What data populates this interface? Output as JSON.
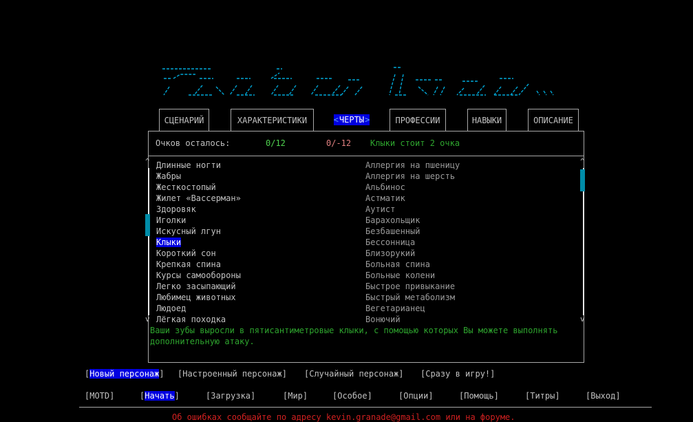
{
  "tabs": [
    {
      "label": "СЦЕНАРИЙ"
    },
    {
      "label": "ХАРАКТЕРИСТИКИ"
    },
    {
      "label": "ЧЕРТЫ",
      "active": true,
      "arrow_left": "<",
      "arrow_right": ">"
    },
    {
      "label": "ПРОФЕССИИ"
    },
    {
      "label": "НАВЫКИ"
    },
    {
      "label": "ОПИСАНИЕ"
    }
  ],
  "points": {
    "label": "Очков осталось:",
    "positive": "0/12",
    "negative": "0/-12",
    "cost": "Клыки стоит 2 очка"
  },
  "positive_traits": [
    "Длинные ногти",
    "Жабры",
    "Жесткостопый",
    "Жилет «Вассерман»",
    "Здоровяк",
    "Иголки",
    "Искусный лгун",
    "Клыки",
    "Короткий сон",
    "Крепкая спина",
    "Курсы самообороны",
    "Легко засыпающий",
    "Любимец животных",
    "Людоед",
    "Лёгкая походка"
  ],
  "negative_traits": [
    "Аллергия на пшеницу",
    "Аллергия на шерсть",
    "Альбинос",
    "Астматик",
    "Аутист",
    "Барахольщик",
    "Безбашенный",
    "Бессонница",
    "Близорукий",
    "Больная спина",
    "Больные колени",
    "Быстрое привыкание",
    "Быстрый метаболизм",
    "Вегетарианец",
    "Вонючий"
  ],
  "selected_index": 7,
  "scroll": {
    "up": "^",
    "down": "v"
  },
  "description": "Ваши зубы выросли в пятисантиметровые клыки, с помощью которых Вы можете выполнять дополнительную атаку.",
  "character_buttons": {
    "new": "Новый персонаж",
    "preset": "Настроенный персонаж",
    "random": "Случайный персонаж",
    "play_now": "Сразу в игру!"
  },
  "menu": {
    "motd": "MOTD",
    "start": "Начать",
    "load": "Загрузка",
    "world": "Мир",
    "special": "Особое",
    "options": "Опции",
    "help": "Помощь",
    "credits": "Титры",
    "exit": "Выход"
  },
  "footer": "Об ошибках сообщайте по адресу kevin.granade@gmail.com или на форуме.",
  "colors": {
    "accent": "#0000e0",
    "logo": "#00a8d8",
    "description": "#2ea52e",
    "positive_value": "#4fd24f",
    "negative_value": "#e08080",
    "footer": "#d02020",
    "scroll_thumb": "#008ca8"
  }
}
